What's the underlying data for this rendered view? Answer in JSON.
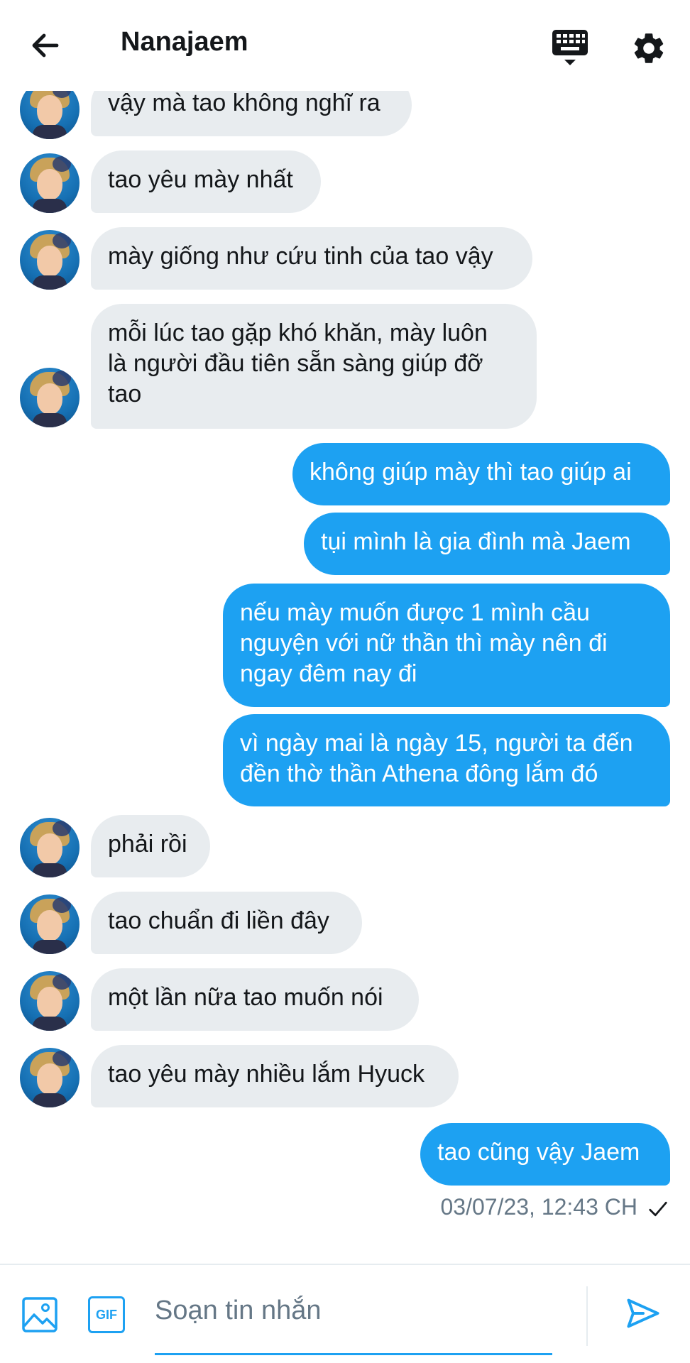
{
  "header": {
    "title": "Nanajaem",
    "back_icon": "arrow-left-icon",
    "keyboard_icon": "keyboard-icon",
    "settings_icon": "gear-icon"
  },
  "messages": [
    {
      "sender": "them",
      "text": "vậy mà tao không nghĩ ra"
    },
    {
      "sender": "them",
      "text": "tao yêu mày nhất"
    },
    {
      "sender": "them",
      "text": "mày giống như cứu tinh của tao vậy"
    },
    {
      "sender": "them",
      "lines": [
        "mỗi lúc tao gặp khó khăn, mày luôn",
        "là người đầu tiên sẵn sàng giúp đỡ",
        "tao"
      ]
    },
    {
      "sender": "me",
      "text": "không giúp mày thì tao giúp ai"
    },
    {
      "sender": "me",
      "text": "tụi mình là gia đình mà Jaem"
    },
    {
      "sender": "me",
      "lines": [
        "nếu mày muốn được 1 mình cầu",
        "nguyện với nữ thần thì mày nên đi",
        "ngay đêm nay đi"
      ]
    },
    {
      "sender": "me",
      "lines": [
        "vì ngày mai là ngày 15, người ta đến",
        "đền thờ thần Athena đông lắm đó"
      ]
    },
    {
      "sender": "them",
      "text": "phải rồi"
    },
    {
      "sender": "them",
      "text": "tao chuẩn đi liền đây"
    },
    {
      "sender": "them",
      "text": "một lần nữa tao muốn nói"
    },
    {
      "sender": "them",
      "text": "tao yêu mày nhiều lắm Hyuck"
    },
    {
      "sender": "me",
      "text": "tao cũng vậy Jaem"
    }
  ],
  "status": {
    "timestamp": "03/07/23, 12:43 CH",
    "read_icon": "checkmark-icon"
  },
  "composer": {
    "placeholder": "Soạn tin nhắn",
    "value": "",
    "image_icon": "image-icon",
    "gif_label": "GIF",
    "send_icon": "send-icon"
  },
  "colors": {
    "accent": "#1da1f2",
    "incoming_bubble": "#e8ecef",
    "text": "#14171a",
    "muted": "#657786"
  }
}
